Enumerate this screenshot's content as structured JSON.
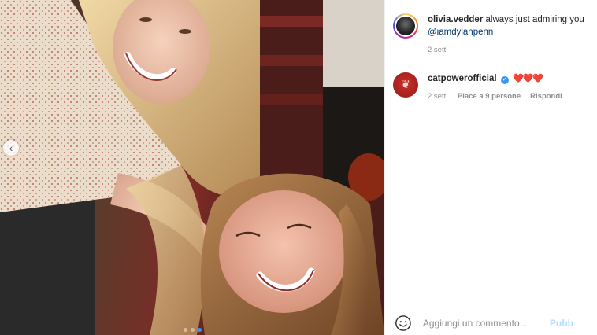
{
  "post": {
    "image_alt": "Two smiling women posing for a selfie",
    "carousel_dots": 3,
    "carousel_active_index": 2
  },
  "caption": {
    "username": "olivia.vedder",
    "text": "always just admiring you",
    "mention": "@iamdylanpenn",
    "time": "2 sett."
  },
  "comment": {
    "username": "catpowerofficial",
    "verified": true,
    "hearts": "❤️❤️❤️",
    "time": "2 sett.",
    "likes": "Piace a 9 persone",
    "reply_label": "Rispondi"
  },
  "composer": {
    "placeholder": "Aggiungi un commento...",
    "post_label": "Pubb"
  },
  "colors": {
    "link_blue": "#00376b",
    "verified_blue": "#3897f0",
    "post_disabled": "#b2dffc",
    "meta_gray": "#8e8e8e"
  }
}
